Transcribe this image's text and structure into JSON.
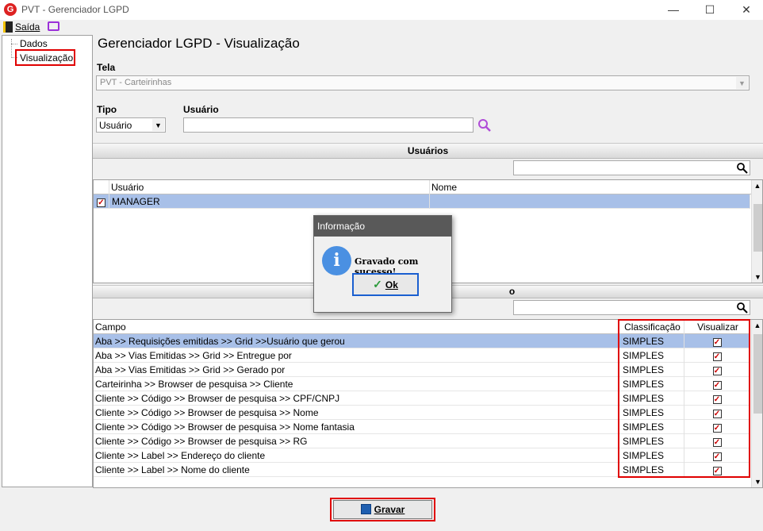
{
  "window": {
    "title": "PVT - Gerenciador LGPD",
    "minimize": "—",
    "maximize": "☐",
    "close": "✕"
  },
  "menu": {
    "exit_label": "Saída"
  },
  "tree": {
    "items": [
      "Dados",
      "Visualização"
    ]
  },
  "page_title": "Gerenciador LGPD - Visualização",
  "tela": {
    "label": "Tela",
    "value": "PVT - Carteirinhas"
  },
  "tipo": {
    "label": "Tipo",
    "value": "Usuário"
  },
  "usuario": {
    "label": "Usuário",
    "value": ""
  },
  "users_section": {
    "title": "Usuários",
    "search_value": "",
    "columns": [
      "Usuário",
      "Nome"
    ],
    "rows": [
      {
        "checked": true,
        "usuario": "MANAGER",
        "nome": ""
      }
    ]
  },
  "fields_section": {
    "title": "o",
    "search_value": "",
    "columns": [
      "Campo",
      "Classificação",
      "Visualizar"
    ],
    "rows": [
      {
        "campo": "Aba >> Requisições emitidas  >> Grid >>Usuário que gerou",
        "classificacao": "SIMPLES",
        "visualizar": true
      },
      {
        "campo": "Aba >> Vias Emitidas >> Grid >> Entregue por",
        "classificacao": "SIMPLES",
        "visualizar": true
      },
      {
        "campo": "Aba >> Vias Emitidas >> Grid >> Gerado por",
        "classificacao": "SIMPLES",
        "visualizar": true
      },
      {
        "campo": "Carteirinha >> Browser de pesquisa >> Cliente",
        "classificacao": "SIMPLES",
        "visualizar": true
      },
      {
        "campo": "Cliente >> Código >> Browser de pesquisa >> CPF/CNPJ",
        "classificacao": "SIMPLES",
        "visualizar": true
      },
      {
        "campo": "Cliente >> Código >> Browser de pesquisa >> Nome",
        "classificacao": "SIMPLES",
        "visualizar": true
      },
      {
        "campo": "Cliente >> Código >> Browser de pesquisa >> Nome fantasia",
        "classificacao": "SIMPLES",
        "visualizar": true
      },
      {
        "campo": "Cliente >> Código >> Browser de pesquisa >> RG",
        "classificacao": "SIMPLES",
        "visualizar": true
      },
      {
        "campo": "Cliente >> Label >> Endereço do cliente",
        "classificacao": "SIMPLES",
        "visualizar": true
      },
      {
        "campo": "Cliente >> Label >> Nome do cliente",
        "classificacao": "SIMPLES",
        "visualizar": true
      }
    ]
  },
  "dialog": {
    "title": "Informação",
    "message": "Gravado com sucesso!",
    "ok_label": "Ok"
  },
  "save_button": {
    "label": "Gravar"
  },
  "colors": {
    "selection": "#a8c0e8",
    "highlight_red": "#e00000",
    "dialog_title": "#595959",
    "info_icon": "#4a90e2"
  }
}
